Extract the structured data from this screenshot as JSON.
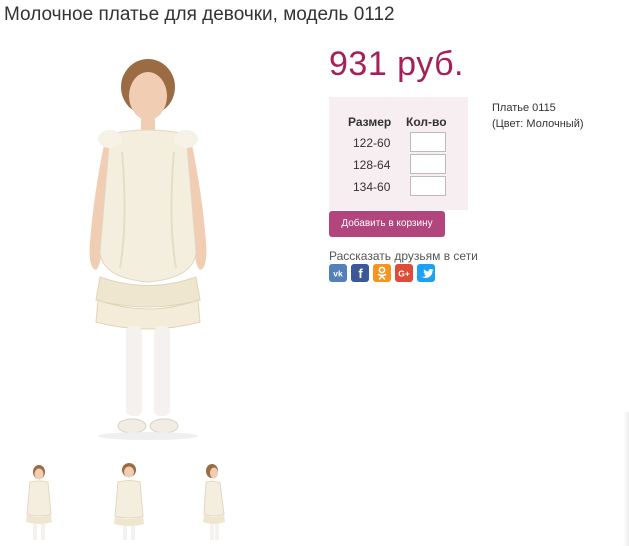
{
  "product": {
    "title": "Молочное платье для девочки, модель 0112",
    "price": "931 руб.",
    "variant_name": "Платье 0115",
    "variant_color": "(Цвет: Молочный)"
  },
  "sizes": {
    "header_size": "Размер",
    "header_qty": "Кол-во",
    "rows": [
      {
        "size": "122-60",
        "qty": ""
      },
      {
        "size": "128-64",
        "qty": ""
      },
      {
        "size": "134-60",
        "qty": ""
      }
    ]
  },
  "actions": {
    "add_to_cart": "Добавить в корзину"
  },
  "share": {
    "label": "Рассказать друзьям в сети",
    "networks": [
      {
        "name": "vk",
        "icon": "vk-icon",
        "color": "#5181b8",
        "glyph": "vk"
      },
      {
        "name": "facebook",
        "icon": "facebook-icon",
        "color": "#3b5998",
        "glyph": "f"
      },
      {
        "name": "odnoklassniki",
        "icon": "odnoklassniki-icon",
        "color": "#f7931e",
        "glyph": "ок"
      },
      {
        "name": "google-plus",
        "icon": "google-plus-icon",
        "color": "#dd4b39",
        "glyph": "G+"
      },
      {
        "name": "twitter",
        "icon": "twitter-icon",
        "color": "#1da1f2",
        "glyph": "t"
      }
    ]
  },
  "gallery": {
    "thumbnails": [
      "front-view",
      "front-view-closeup",
      "side-view"
    ]
  },
  "colors": {
    "accent": "#a51f5b",
    "button": "#b2457b",
    "panel": "#f6eef1"
  }
}
